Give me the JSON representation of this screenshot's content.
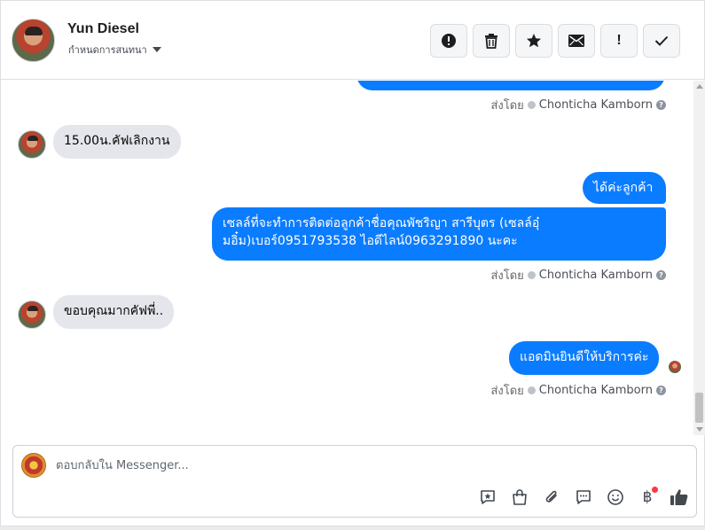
{
  "header": {
    "contact_name": "Yun Diesel",
    "assign_label": "กำหนดการสนทนา",
    "actions": [
      {
        "name": "spam-button",
        "icon": "alert-circle-icon"
      },
      {
        "name": "delete-button",
        "icon": "trash-icon"
      },
      {
        "name": "star-button",
        "icon": "star-icon"
      },
      {
        "name": "mark-unread-button",
        "icon": "envelope-icon"
      },
      {
        "name": "follow-up-button",
        "icon": "exclamation-icon",
        "label": "!"
      },
      {
        "name": "mark-done-button",
        "icon": "checkmark-icon"
      }
    ]
  },
  "messages": [
    {
      "direction": "out",
      "text": "",
      "partial": true
    },
    {
      "sent_by": {
        "prefix": "ส่งโดย",
        "name": "Chonticha Kamborn"
      }
    },
    {
      "direction": "in",
      "text": "15.00น.คัฟเลิกงาน"
    },
    {
      "direction": "out",
      "text": "ได้ค่ะลูกค้า"
    },
    {
      "direction": "out",
      "text": "เซลล์ที่จะทำการติดต่อลูกค้าชื่อคุณพัชริญา สารีบุตร (เซลล์อุ๋มอิ๋ม)เบอร์0951793538 ไอดีไลน์0963291890 นะคะ"
    },
    {
      "sent_by": {
        "prefix": "ส่งโดย",
        "name": "Chonticha Kamborn"
      }
    },
    {
      "direction": "in",
      "text": "ขอบคุณมากคัฟพี่.."
    },
    {
      "direction": "out",
      "text": "แอดมินยินดีให้บริการค่ะ"
    },
    {
      "sent_by": {
        "prefix": "ส่งโดย",
        "name": "Chonticha Kamborn"
      }
    }
  ],
  "composer": {
    "placeholder": "ตอบกลับใน Messenger...",
    "tools": [
      "saved-reply-icon",
      "shopping-bag-icon",
      "paperclip-icon",
      "chat-bubble-icon",
      "emoji-icon",
      "baht-payment-icon",
      "thumbs-up-icon"
    ],
    "baht_symbol": "฿"
  },
  "colors": {
    "outgoing_bubble": "#0a7cff",
    "incoming_bubble": "#e4e6eb",
    "notification_dot": "#fa383e"
  }
}
